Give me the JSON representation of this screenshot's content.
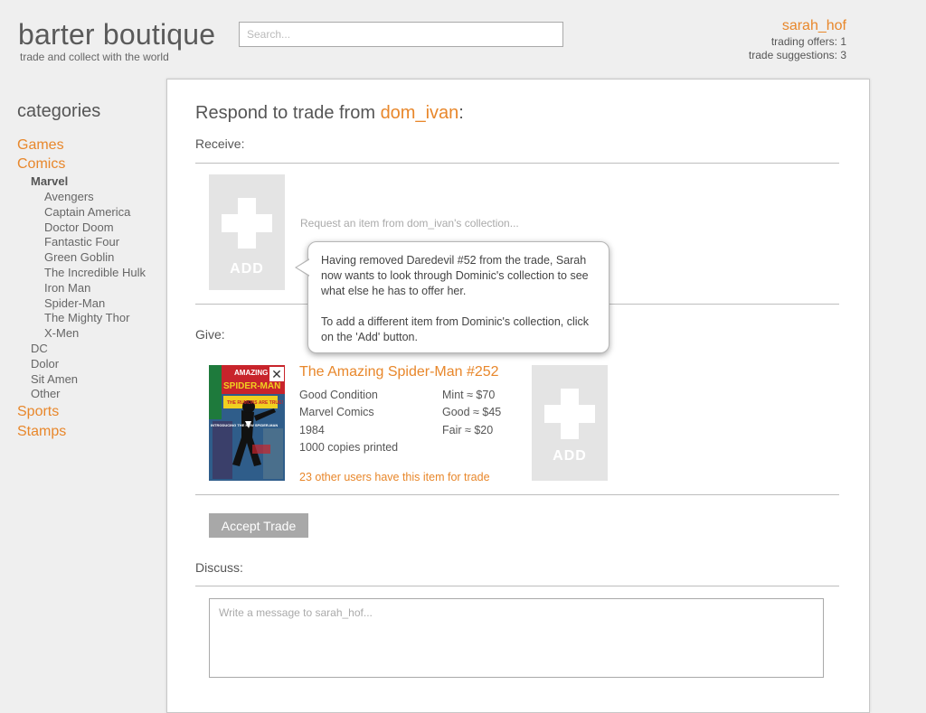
{
  "header": {
    "logo": "barter boutique",
    "tagline": "trade and collect with the world",
    "search_placeholder": "Search...",
    "username": "sarah_hof",
    "trading_offers": "trading offers: 1",
    "trade_suggestions": "trade suggestions: 3"
  },
  "sidebar": {
    "title": "categories",
    "games": "Games",
    "comics": "Comics",
    "marvel": "Marvel",
    "marvel_items": [
      "Avengers",
      "Captain America",
      "Doctor Doom",
      "Fantastic Four",
      "Green Goblin",
      "The Incredible Hulk",
      "Iron Man",
      "Spider-Man",
      "The Mighty Thor",
      "X-Men"
    ],
    "comic_publishers": [
      "DC",
      "Dolor",
      "Sit Amen",
      "Other"
    ],
    "sports": "Sports",
    "stamps": "Stamps"
  },
  "trade": {
    "title_prefix": "Respond to trade from ",
    "partner": "dom_ivan",
    "title_suffix": ":",
    "receive_label": "Receive:",
    "request_placeholder": "Request an item from dom_ivan's collection...",
    "add_label": "ADD",
    "give_label": "Give:",
    "item": {
      "title": "The Amazing Spider-Man #252",
      "cover_top_text": "AMAZING",
      "cover_brand": "SPIDER-MAN",
      "cover_blurb": "THE RUMORS ARE TRUE!",
      "cover_side": "INTRODUCING THE NEW SPIDER-MAN",
      "condition": "Good Condition",
      "publisher": "Marvel Comics",
      "year": "1984",
      "copies": "1000 copies printed",
      "price_mint": "Mint ≈ $70",
      "price_good": "Good ≈ $45",
      "price_fair": "Fair ≈ $20",
      "others": "23 other users have this item for trade",
      "remove_symbol": "✕"
    },
    "accept_label": "Accept Trade",
    "discuss_label": "Discuss:",
    "message_placeholder": "Write a message to sarah_hof..."
  },
  "tooltip": {
    "line1": "Having removed Daredevil #52 from the trade, Sarah now wants to look through Dominic's collection to see what else he has to offer her.",
    "line2": "To add a different item from Dominic's collection, click on the 'Add' button."
  },
  "colors": {
    "accent": "#e8872b",
    "background": "#efefef",
    "add_box": "#e4e4e4",
    "button": "#a8a8a8"
  }
}
